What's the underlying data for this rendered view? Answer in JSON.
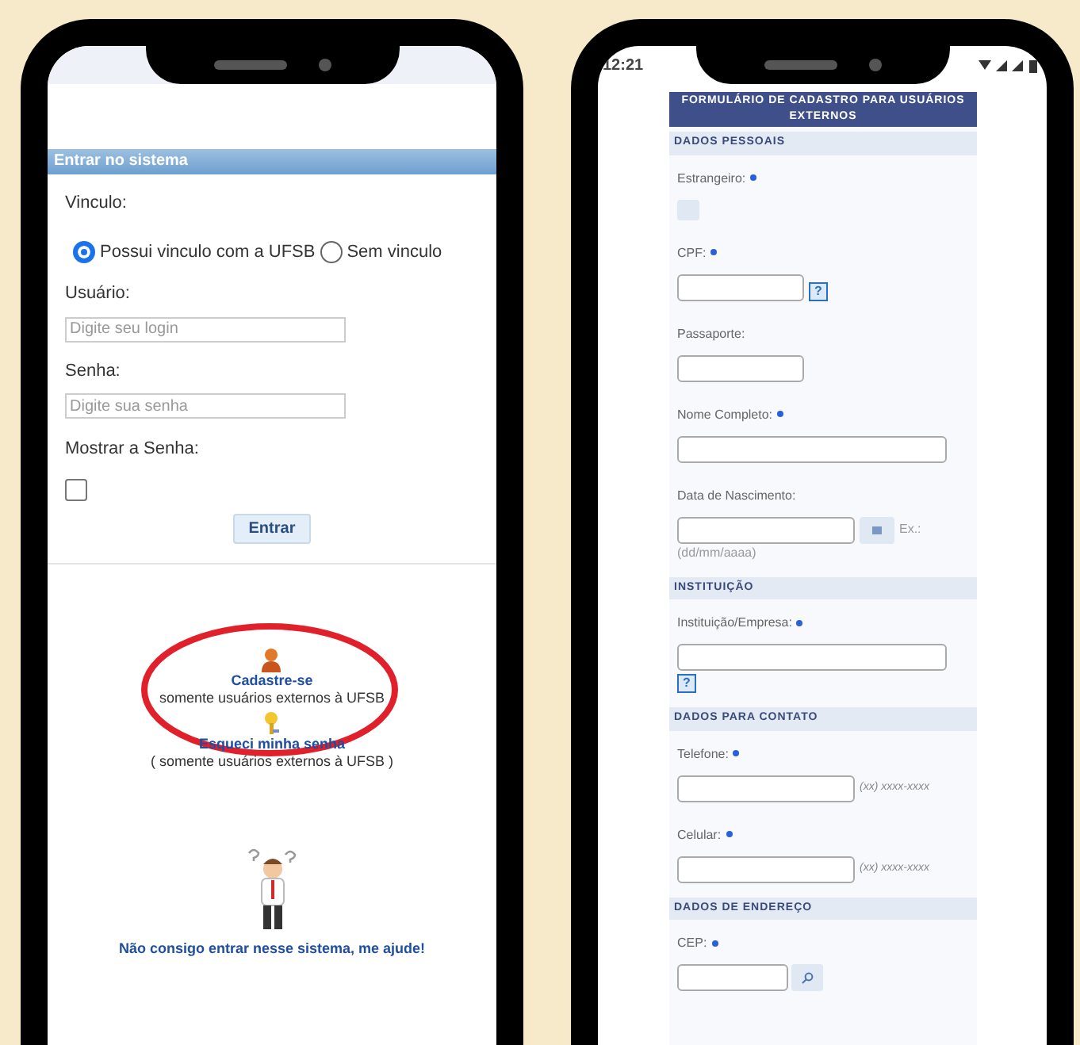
{
  "login_screen": {
    "header": "Entrar no sistema",
    "bond_label": "Vinculo:",
    "radios": [
      {
        "label": "Possui vinculo com a UFSB",
        "selected": true
      },
      {
        "label": "Sem vinculo",
        "selected": false
      }
    ],
    "fields": [
      {
        "label": "Usuário:",
        "placeholder": "Digite seu login"
      },
      {
        "label": "Senha:",
        "placeholder": "Digite sua senha"
      }
    ],
    "show_password": {
      "label": "Mostrar a Senha:",
      "checked": false
    },
    "submit": "Entrar",
    "links": [
      {
        "kind": "register",
        "title": "Cadastre-se",
        "note": "somente usuários externos à UFSB",
        "highlighted": true
      },
      {
        "kind": "forgot",
        "title": "Esqueci minha senha",
        "note": "( somente usuários externos à UFSB )",
        "highlighted": false
      }
    ],
    "help": "Não consigo entrar nesse sistema, me ajude!"
  },
  "register_screen": {
    "time": "12:21",
    "title": "FORMULÁRIO DE CADASTRO PARA USUÁRIOS EXTERNOS",
    "sections": [
      {
        "title": "DADOS PESSOAIS",
        "fields": [
          {
            "kind": "checkbox",
            "label": "Estrangeiro:",
            "required": true,
            "checked": false
          },
          {
            "kind": "short",
            "label": "CPF:",
            "required": true,
            "help": "?"
          },
          {
            "kind": "short",
            "label": "Passaporte:",
            "required": false
          },
          {
            "kind": "wide",
            "label": "Nome Completo:",
            "required": true
          },
          {
            "kind": "date",
            "label": "Data de Nascimento:",
            "required": false,
            "hint": "Ex.:",
            "format": "(dd/mm/aaaa)"
          }
        ]
      },
      {
        "title": "INSTITUIÇÃO",
        "fields": [
          {
            "kind": "wide",
            "label": "Instituição/Empresa:",
            "required": true,
            "help": "?"
          }
        ]
      },
      {
        "title": "DADOS PARA CONTATO",
        "fields": [
          {
            "kind": "phone",
            "label": "Telefone:",
            "required": true,
            "hint": "(xx) xxxx-xxxx"
          },
          {
            "kind": "phone",
            "label": "Celular:",
            "required": true,
            "hint": "(xx) xxxx-xxxx"
          }
        ]
      },
      {
        "title": "DADOS DE ENDEREÇO",
        "fields": [
          {
            "kind": "cep",
            "label": "CEP:",
            "required": true
          }
        ]
      }
    ]
  }
}
